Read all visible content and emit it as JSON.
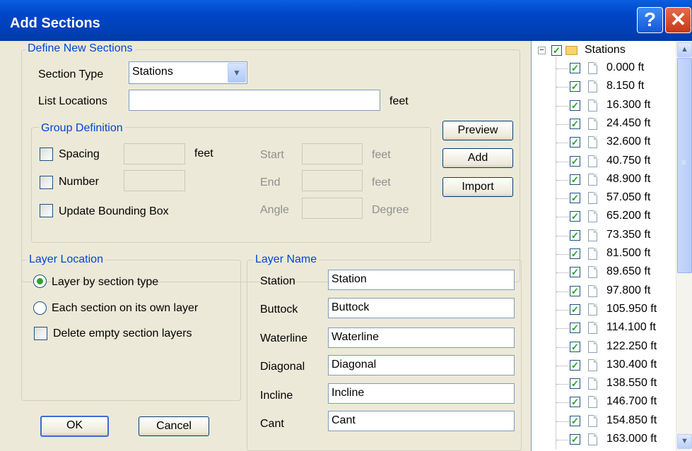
{
  "window": {
    "title": "Add Sections",
    "help_glyph": "?",
    "close_glyph": "✕"
  },
  "define": {
    "legend": "Define New Sections",
    "section_type_label": "Section Type",
    "section_type_value": "Stations",
    "list_locations_label": "List Locations",
    "list_locations_value": "",
    "list_locations_unit": "feet"
  },
  "group": {
    "legend": "Group Definition",
    "spacing_label": "Spacing",
    "spacing_value": "",
    "spacing_unit": "feet",
    "number_label": "Number",
    "number_value": "",
    "update_bbox_label": "Update Bounding Box",
    "start_label": "Start",
    "start_value": "",
    "start_unit": "feet",
    "end_label": "End",
    "end_value": "",
    "end_unit": "feet",
    "angle_label": "Angle",
    "angle_value": "",
    "angle_unit": "Degree"
  },
  "buttons": {
    "preview": "Preview",
    "add": "Add",
    "import": "Import",
    "ok": "OK",
    "cancel": "Cancel"
  },
  "layer_location": {
    "legend": "Layer Location",
    "by_type": "Layer by section type",
    "own_layer": "Each section on its own layer",
    "delete_empty": "Delete empty section layers"
  },
  "layer_name": {
    "legend": "Layer Name",
    "rows": [
      {
        "label": "Station",
        "value": "Station"
      },
      {
        "label": "Buttock",
        "value": "Buttock"
      },
      {
        "label": "Waterline",
        "value": "Waterline"
      },
      {
        "label": "Diagonal",
        "value": "Diagonal"
      },
      {
        "label": "Incline",
        "value": "Incline"
      },
      {
        "label": "Cant",
        "value": "Cant"
      }
    ]
  },
  "tree": {
    "root": "Stations",
    "collapse_glyph": "−",
    "check_glyph": "✓",
    "items": [
      "0.000 ft",
      "8.150 ft",
      "16.300 ft",
      "24.450 ft",
      "32.600 ft",
      "40.750 ft",
      "48.900 ft",
      "57.050 ft",
      "65.200 ft",
      "73.350 ft",
      "81.500 ft",
      "89.650 ft",
      "97.800 ft",
      "105.950 ft",
      "114.100 ft",
      "122.250 ft",
      "130.400 ft",
      "138.550 ft",
      "146.700 ft",
      "154.850 ft",
      "163.000 ft"
    ]
  },
  "scrollbar": {
    "up": "▲",
    "down": "▼",
    "grip": "≡"
  },
  "combo_arrow": "▼"
}
